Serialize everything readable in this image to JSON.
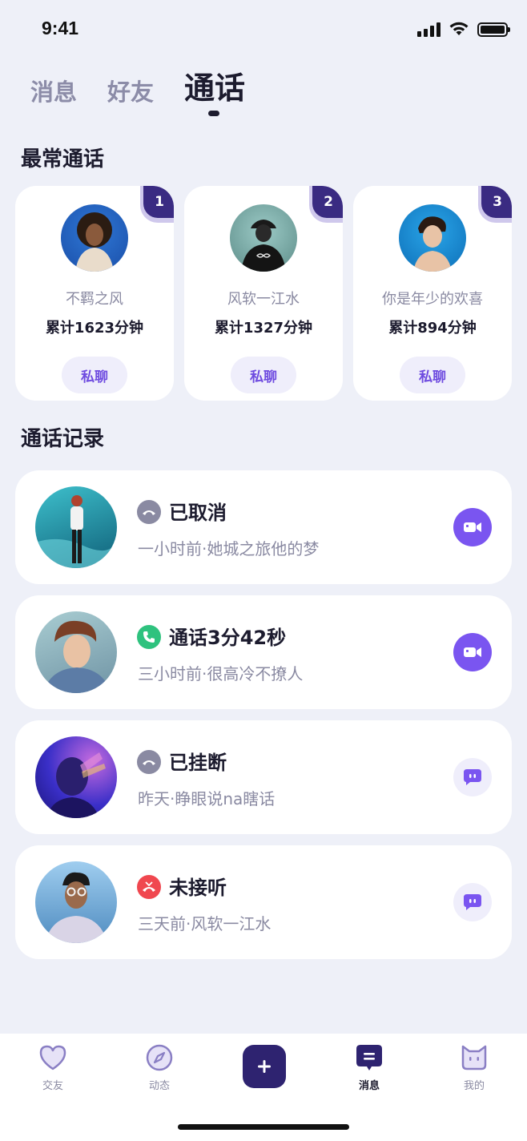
{
  "status_bar": {
    "time": "9:41"
  },
  "tabs": [
    {
      "label": "消息",
      "active": false
    },
    {
      "label": "好友",
      "active": false
    },
    {
      "label": "通话",
      "active": true
    }
  ],
  "favorites": {
    "title": "最常通话",
    "items": [
      {
        "rank": "1",
        "name": "不羁之风",
        "total": "累计1623分钟",
        "button": "私聊",
        "avatar_colors": [
          "#2f78d6",
          "#1a4ea8"
        ]
      },
      {
        "rank": "2",
        "name": "风软一江水",
        "total": "累计1327分钟",
        "button": "私聊",
        "avatar_colors": [
          "#7fb3b0",
          "#3e6f6c"
        ]
      },
      {
        "rank": "3",
        "name": "你是年少的欢喜",
        "total": "累计894分钟",
        "button": "私聊",
        "avatar_colors": [
          "#2aa5e8",
          "#0d6fb8"
        ]
      }
    ]
  },
  "records": {
    "title": "通话记录",
    "items": [
      {
        "status": "已取消",
        "subtitle": "一小时前·她城之旅他的梦",
        "status_type": "cancelled",
        "status_color": "#8a8aa2",
        "action": "video",
        "avatar_colors": [
          "#34a9b8",
          "#146b80"
        ]
      },
      {
        "status": "通话3分42秒",
        "subtitle": "三小时前·很高冷不撩人",
        "status_type": "connected",
        "status_color": "#2ec27e",
        "action": "video",
        "avatar_colors": [
          "#9ec3c9",
          "#6a8ea0"
        ]
      },
      {
        "status": "已挂断",
        "subtitle": "昨天·睁眼说na瞎话",
        "status_type": "hungup",
        "status_color": "#8a8aa2",
        "action": "message",
        "avatar_colors": [
          "#5a4de0",
          "#241a8c"
        ]
      },
      {
        "status": "未接听",
        "subtitle": "三天前·风软一江水",
        "status_type": "missed",
        "status_color": "#f0474f",
        "action": "message",
        "avatar_colors": [
          "#8fc2e6",
          "#4f8cc0"
        ]
      }
    ]
  },
  "nav": {
    "items": [
      {
        "label": "交友",
        "icon": "heart-icon",
        "active": false
      },
      {
        "label": "动态",
        "icon": "compass-icon",
        "active": false
      },
      {
        "label": "",
        "icon": "plus-icon",
        "active": false
      },
      {
        "label": "消息",
        "icon": "message-icon",
        "active": true
      },
      {
        "label": "我的",
        "icon": "profile-icon",
        "active": false
      }
    ]
  },
  "colors": {
    "accent": "#7a55f0",
    "dark": "#2e2370",
    "background": "#eef0f8"
  }
}
